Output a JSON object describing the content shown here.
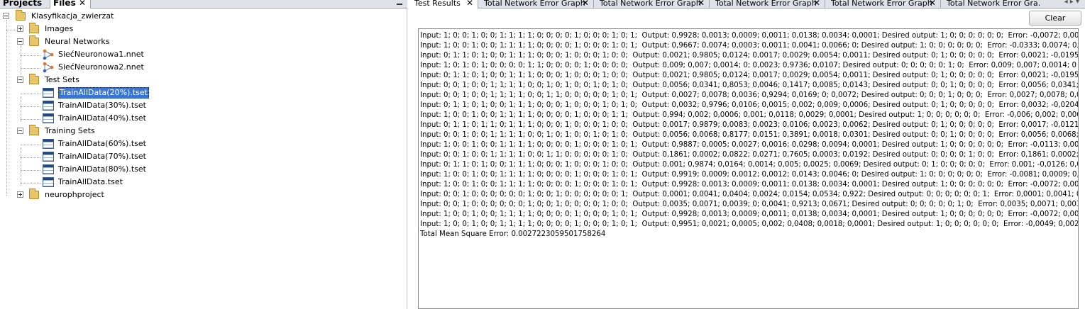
{
  "left": {
    "tabs": [
      {
        "label": "Projects"
      },
      {
        "label": "Files",
        "close": "✕"
      }
    ],
    "tree": {
      "root": "Klasyfikacja_zwierzat",
      "images": "Images",
      "neural_networks": "Neural Networks",
      "networks": [
        "SiećNeuronowa1.nnet",
        "SiećNeuronowa2.nnet"
      ],
      "test_sets": "Test Sets",
      "test_items": [
        "TrainAllData(20%).tset",
        "TrainAllData(30%).tset",
        "TrainAllData(40%).tset"
      ],
      "training_sets": "Training Sets",
      "training_items": [
        "TrainAllData(60%).tset",
        "TrainAllData(70%).tset",
        "TrainAllData(80%).tset",
        "TrainAllData.tset"
      ],
      "project": "neurophproject",
      "selected": "TrainAllData(20%).tset"
    }
  },
  "right": {
    "tabs": [
      {
        "label": "Test Results",
        "close": "✕"
      },
      {
        "label": "Total Network Error Graph",
        "close": "✕"
      },
      {
        "label": "Total Network Error Graph",
        "close": "✕"
      },
      {
        "label": "Total Network Error Graph",
        "close": "✕"
      },
      {
        "label": "Total Network Error Graph",
        "close": "✕"
      },
      {
        "label": "Total Network Error Gra...",
        "close": ""
      }
    ],
    "nav_arrows": "◂ ▸ ▾",
    "clear_label": "Clear",
    "lines": [
      "Input: 1; 0; 0; 1; 0; 0; 1; 1; 1; 1; 0; 0; 0; 0; 1; 0; 0; 0; 1; 0; 1;  Output: 0,9928; 0,0013; 0,0009; 0,0011; 0,0138; 0,0034; 0,0001; Desired output: 1; 0; 0; 0; 0; 0; 0;  Error: -0,0072; 0,0013; 0",
      "Input: 1; 0; 0; 1; 0; 0; 1; 1; 1; 1; 0; 0; 0; 0; 1; 0; 0; 0; 1; 0; 1;  Output: 0,9667; 0,0074; 0,0003; 0,0011; 0,0041; 0,0066; 0; Desired output: 1; 0; 0; 0; 0; 0; 0;  Error: -0,0333; 0,0074; 0,0003",
      "Input: 0; 1; 1; 0; 1; 0; 0; 1; 1; 1; 0; 0; 0; 1; 0; 0; 0; 1; 0; 0;  Output: 0,0021; 0,9805; 0,0124; 0,0017; 0,0029; 0,0054; 0,0011; Desired output: 0; 1; 0; 0; 0; 0; 0;  Error: 0,0021; -0,0195; 0",
      "Input: 1; 0; 1; 0; 1; 0; 0; 0; 0; 1; 1; 0; 0; 0; 0; 1; 0; 0; 0; 0;  Output: 0,009; 0,007; 0,0014; 0; 0,0023; 0,9736; 0,0107; Desired output: 0; 0; 0; 0; 0; 1; 0;  Error: 0,009; 0,007; 0,0014; 0",
      "Input: 0; 1; 1; 0; 1; 0; 0; 1; 1; 1; 0; 0; 0; 1; 0; 0; 0; 1; 0; 0;  Output: 0,0021; 0,9805; 0,0124; 0,0017; 0,0029; 0,0054; 0,0011; Desired output: 0; 1; 0; 0; 0; 0; 0;  Error: 0,0021; -0,0195; 0",
      "Input: 0; 0; 1; 0; 0; 1; 1; 1; 1; 0; 0; 1; 0; 1; 0; 0; 1; 0; 1; 0;  Output: 0,0056; 0,0341; 0,8053; 0,0046; 0,1417; 0,0085; 0,0143; Desired output: 0; 0; 1; 0; 0; 0; 0;  Error: 0,0056; 0,0341; -0",
      "Input: 0; 0; 1; 0; 0; 1; 1; 1; 1; 0; 0; 1; 1; 0; 0; 0; 0; 0; 1; 0; 1;  Output: 0,0027; 0,0078; 0,0036; 0,9294; 0,0169; 0; 0,0072; Desired output: 0; 0; 0; 1; 0; 0; 0;  Error: 0,0027; 0,0078; 0,0036",
      "Input: 0; 1; 1; 0; 1; 0; 0; 1; 1; 1; 0; 0; 0; 1; 0; 0; 0; 1; 0; 1; 0;  Output: 0,0032; 0,9796; 0,0106; 0,0015; 0,002; 0,009; 0,0006; Desired output: 0; 1; 0; 0; 0; 0; 0;  Error: 0,0032; -0,0204; 0,0",
      "Input: 1; 0; 0; 1; 0; 0; 1; 1; 1; 1; 0; 0; 0; 0; 1; 0; 0; 0; 1; 1;  Output: 0,994; 0,002; 0,0006; 0,001; 0,0118; 0,0029; 0,0001; Desired output: 1; 0; 0; 0; 0; 0; 0;  Error: -0,006; 0,002; 0,0006",
      "Input: 0; 1; 1; 0; 1; 1; 0; 1; 1; 1; 0; 0; 0; 1; 0; 0; 0; 1; 0; 0;  Output: 0,0017; 0,9879; 0,0083; 0,0023; 0,0106; 0,0023; 0,0062; Desired output: 0; 1; 0; 0; 0; 0; 0;  Error: 0,0017; -0,0121; 0",
      "Input: 0; 0; 1; 0; 0; 1; 1; 1; 1; 0; 0; 1; 0; 1; 0; 0; 1; 0; 1; 0;  Output: 0,0056; 0,0068; 0,8177; 0,0151; 0,3891; 0,0018; 0,0301; Desired output: 0; 0; 1; 0; 0; 0; 0;  Error: 0,0056; 0,0068; -0",
      "Input: 1; 0; 0; 1; 0; 0; 1; 1; 1; 1; 0; 0; 0; 0; 1; 0; 0; 0; 1; 0; 1;  Output: 0,9887; 0,0005; 0,0027; 0,0016; 0,0298; 0,0094; 0,0001; Desired output: 1; 0; 0; 0; 0; 0; 0;  Error: -0,0113; 0,0005; 0",
      "Input: 0; 0; 1; 0; 0; 1; 1; 1; 1; 0; 0; 1; 1; 0; 0; 0; 0; 0; 1; 0;  Output: 0,1861; 0,0002; 0,0822; 0,0271; 0,7605; 0,0003; 0,0192; Desired output: 0; 0; 0; 0; 1; 0; 0;  Error: 0,1861; 0,0002; 0,0",
      "Input: 0; 1; 1; 0; 1; 0; 0; 1; 1; 1; 0; 0; 0; 1; 0; 0; 0; 1; 0; 0;  Output: 0,001; 0,9874; 0,0164; 0,0014; 0,005; 0,0025; 0,0069; Desired output: 0; 1; 0; 0; 0; 0; 0;  Error: 0,001; -0,0126; 0,01",
      "Input: 1; 0; 0; 1; 0; 0; 1; 1; 1; 1; 0; 0; 0; 0; 1; 0; 0; 0; 1; 0; 1;  Output: 0,9919; 0,0009; 0,0012; 0,0012; 0,0143; 0,0046; 0; Desired output: 1; 0; 0; 0; 0; 0; 0;  Error: -0,0081; 0,0009; 0,0012",
      "Input: 1; 0; 0; 1; 0; 0; 1; 1; 1; 1; 0; 0; 0; 0; 1; 0; 0; 0; 1; 0; 1;  Output: 0,9928; 0,0013; 0,0009; 0,0011; 0,0138; 0,0034; 0,0001; Desired output: 1; 0; 0; 0; 0; 0; 0;  Error: -0,0072; 0,0013; 0",
      "Input: 0; 0; 1; 0; 0; 0; 0; 0; 0; 1; 0; 0; 1; 0; 0; 0; 0; 0; 0; 1;  Output: 0,0001; 0,0041; 0,0404; 0,0024; 0,0154; 0,0534; 0,922; Desired output: 0; 0; 0; 0; 0; 0; 1;  Error: 0,0001; 0,0041; 0,0",
      "Input: 0; 0; 1; 0; 0; 0; 0; 0; 0; 1; 0; 0; 1; 0; 0; 0; 0; 1; 0; 0;  Output: 0,0035; 0,0071; 0,0039; 0; 0,0041; 0,9213; 0,0671; Desired output: 0; 0; 0; 0; 0; 1; 0;  Error: 0,0035; 0,0071; 0,0039",
      "Input: 1; 0; 0; 1; 0; 0; 1; 1; 1; 1; 0; 0; 0; 0; 1; 0; 0; 0; 1; 0; 1;  Output: 0,9928; 0,0013; 0,0009; 0,0011; 0,0138; 0,0034; 0,0001; Desired output: 1; 0; 0; 0; 0; 0; 0;  Error: -0,0072; 0,0013; 0",
      "Input: 1; 0; 0; 1; 0; 0; 1; 1; 1; 1; 0; 0; 0; 0; 1; 0; 0; 0; 1; 0; 1;  Output: 0,9951; 0,0021; 0,0005; 0,002; 0,0408; 0,0018; 0,0001; Desired output: 1; 0; 0; 0; 0; 0; 0;  Error: -0,0049; 0,0021; 0,",
      "Total Mean Square Error: 0.0027223059501758264"
    ]
  }
}
